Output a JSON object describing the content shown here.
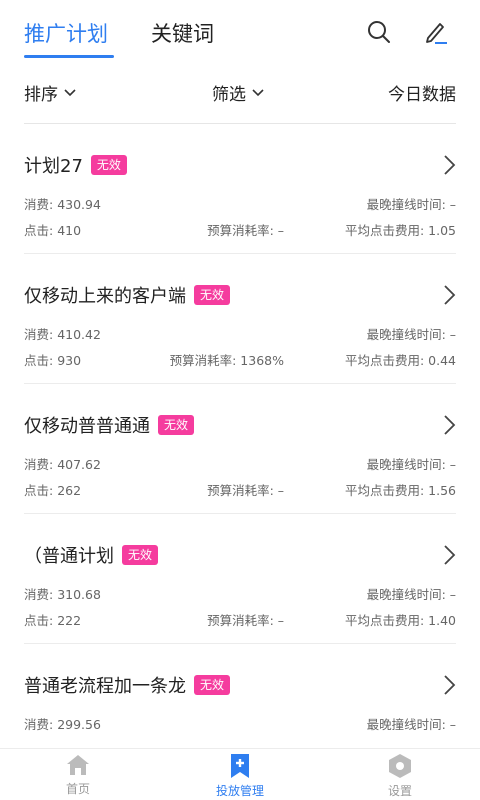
{
  "header": {
    "tab_plans": "推广计划",
    "tab_keywords": "关键词",
    "search_icon": "search-icon",
    "edit_icon": "pencil-icon"
  },
  "filters": {
    "sort": "排序",
    "filter": "筛选",
    "today": "今日数据"
  },
  "labels": {
    "cost": "消费: ",
    "clicks": "点击: ",
    "latest_time": "最晚撞线时间: ",
    "budget_rate": "预算消耗率: ",
    "avg_cpc": "平均点击费用: "
  },
  "plans": [
    {
      "name": "计划27",
      "status": "无效",
      "cost": "430.94",
      "latest": "–",
      "clicks": "410",
      "budget_rate": "–",
      "avg_cpc": "1.05"
    },
    {
      "name": "仅移动上来的客户端",
      "status": "无效",
      "cost": "410.42",
      "latest": "–",
      "clicks": "930",
      "budget_rate": "1368%",
      "avg_cpc": "0.44"
    },
    {
      "name": "仅移动普普通通",
      "status": "无效",
      "cost": "407.62",
      "latest": "–",
      "clicks": "262",
      "budget_rate": "–",
      "avg_cpc": "1.56"
    },
    {
      "name": "（普通计划",
      "status": "无效",
      "cost": "310.68",
      "latest": "–",
      "clicks": "222",
      "budget_rate": "–",
      "avg_cpc": "1.40"
    },
    {
      "name": "普通老流程加一条龙",
      "status": "无效",
      "cost": "299.56",
      "latest": "–",
      "clicks": "",
      "budget_rate": "",
      "avg_cpc": ""
    }
  ],
  "tabbar": {
    "home": "首页",
    "ads": "投放管理",
    "settings": "设置"
  },
  "colors": {
    "accent": "#2f7ef0",
    "badge": "#f53c9e"
  }
}
